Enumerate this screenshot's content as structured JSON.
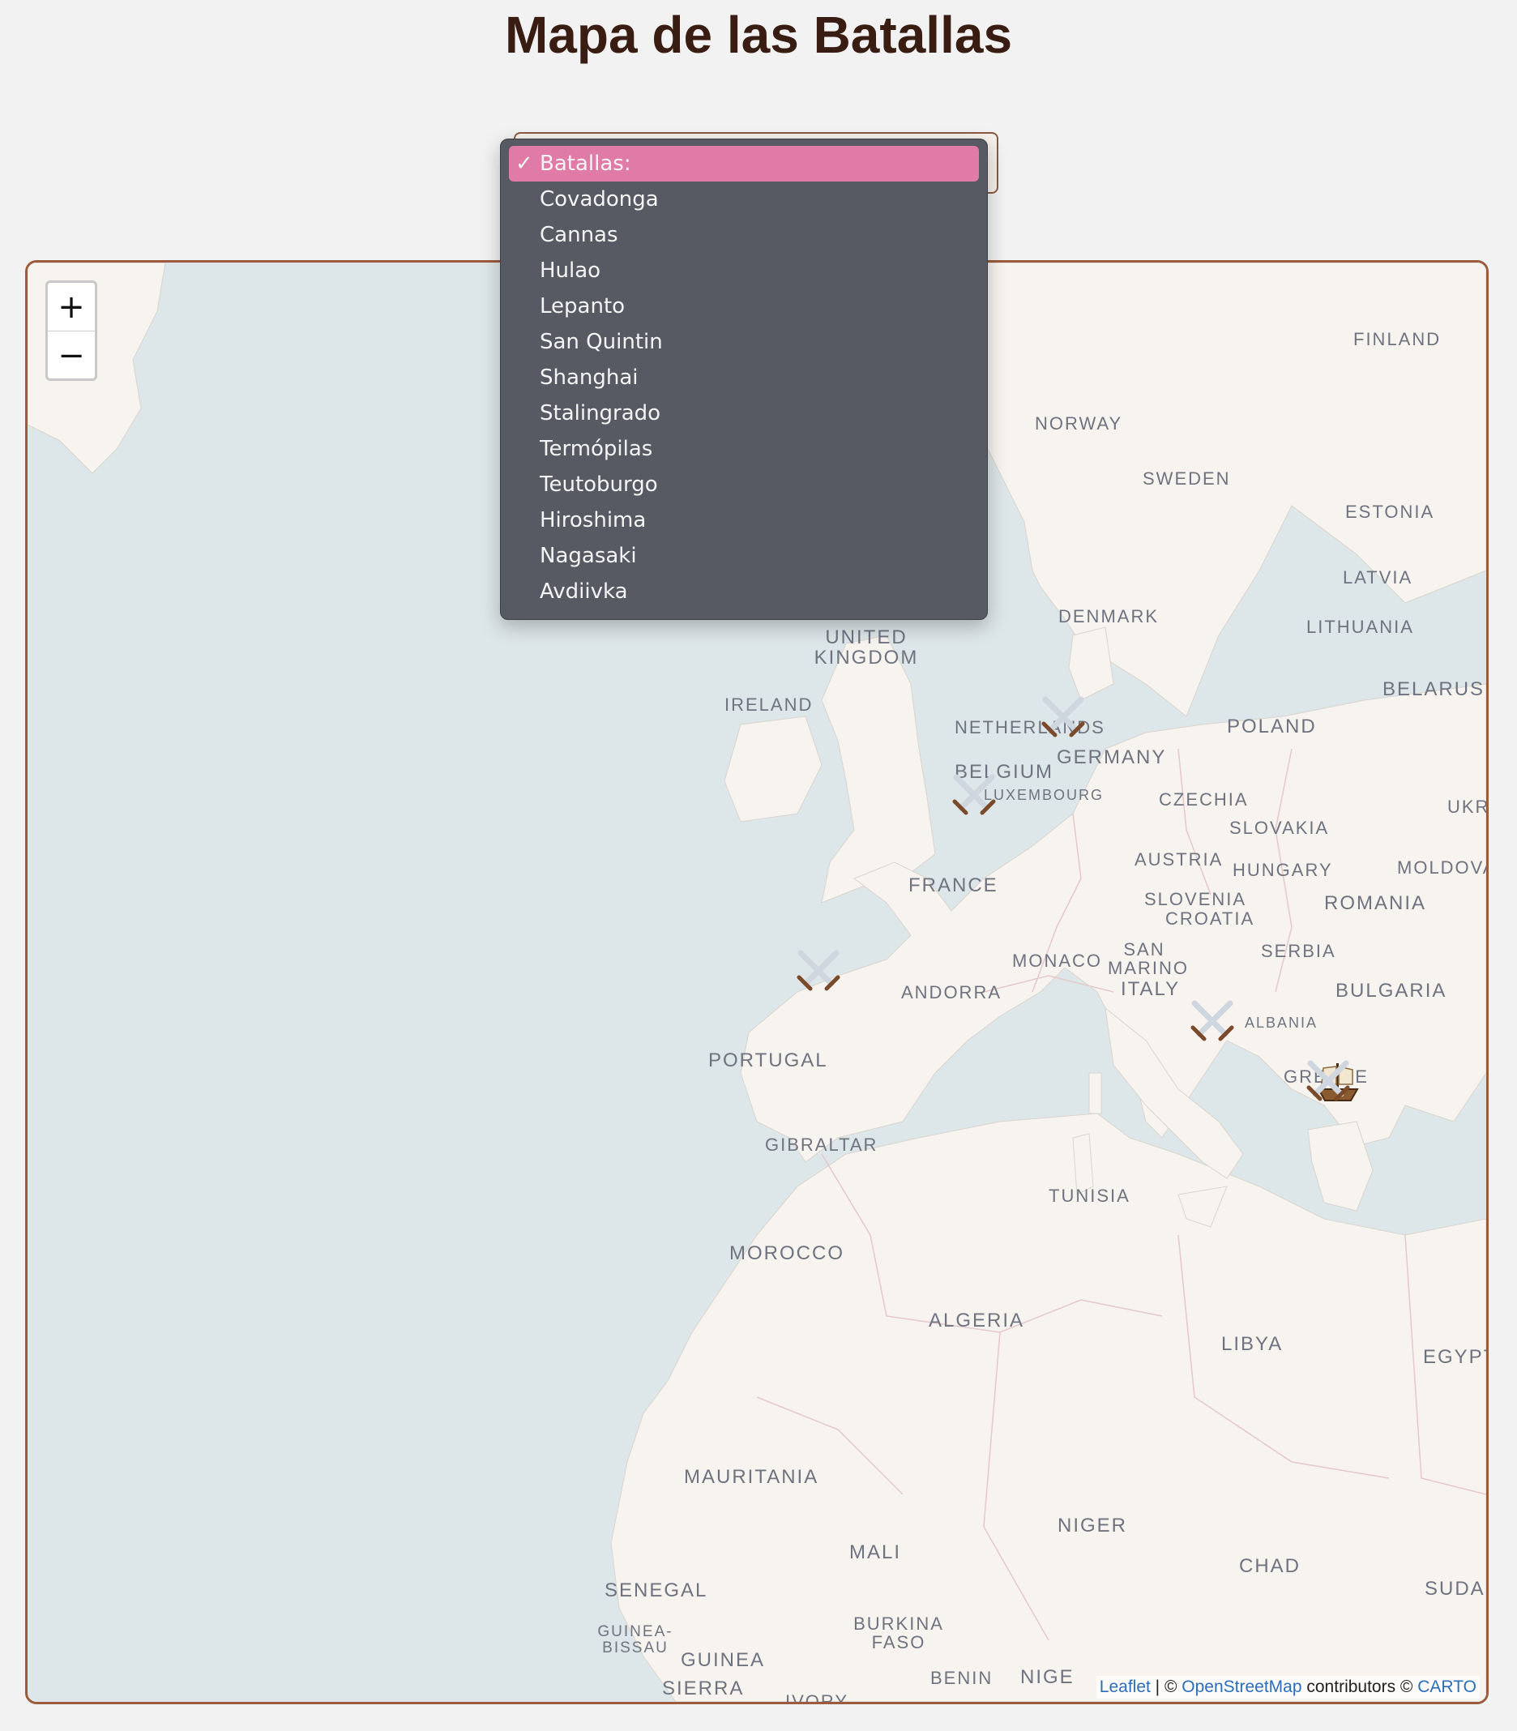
{
  "page": {
    "title": "Mapa de las Batallas"
  },
  "select": {
    "selected": "Batallas:",
    "options": [
      "Batallas:",
      "Covadonga",
      "Cannas",
      "Hulao",
      "Lepanto",
      "San Quintin",
      "Shanghai",
      "Stalingrado",
      "Termópilas",
      "Teutoburgo",
      "Hiroshima",
      "Nagasaki",
      "Avdiivka"
    ]
  },
  "map": {
    "zoom_in": "+",
    "zoom_out": "−",
    "labels": {
      "finland": "FINLAND",
      "norway": "NORWAY",
      "sweden": "SWEDEN",
      "estonia": "ESTONIA",
      "latvia": "LATVIA",
      "denmark": "DENMARK",
      "lithuania": "LITHUANIA",
      "united_kingdom": "UNITED KINGDOM",
      "belarus": "BELARUS",
      "ireland": "IRELAND",
      "poland": "POLAND",
      "netherlands": "NETHERLANDS",
      "germany": "GERMANY",
      "belgium": "BELGIUM",
      "luxembourg": "LUXEMBOURG",
      "czechia": "CZECHIA",
      "ukraine": "UKR",
      "slovakia": "SLOVAKIA",
      "austria": "AUSTRIA",
      "hungary": "HUNGARY",
      "moldova": "MOLDOVA",
      "france": "FRANCE",
      "slovenia": "SLOVENIA",
      "croatia": "CROATIA",
      "romania": "ROMANIA",
      "san_marino": "SAN MARINO",
      "serbia": "SERBIA",
      "monaco": "MONACO",
      "italy": "ITALY",
      "andorra": "ANDORRA",
      "bulgaria": "BULGARIA",
      "albania": "ALBANIA",
      "portugal": "PORTUGAL",
      "greece": "GREECE",
      "gibraltar": "GIBRALTAR",
      "tunisia": "TUNISIA",
      "morocco": "MOROCCO",
      "algeria": "ALGERIA",
      "libya": "LIBYA",
      "egypt": "EGYPT",
      "mauritania": "MAURITANIA",
      "niger": "NIGER",
      "mali": "MALI",
      "chad": "CHAD",
      "senegal": "SENEGAL",
      "sudan": "SUDAN",
      "burkina_faso": "BURKINA FASO",
      "guinea_bissau": "GUINEA-BISSAU",
      "guinea": "GUINEA",
      "benin": "BENIN",
      "nigeria": "NIGE",
      "sierra": "SIERRA",
      "ivory": "IVORY"
    },
    "markers": [
      {
        "name": "Teutoburgo",
        "icon": "crossed-swords-icon"
      },
      {
        "name": "San Quintin",
        "icon": "crossed-swords-icon"
      },
      {
        "name": "Covadonga",
        "icon": "crossed-swords-icon"
      },
      {
        "name": "Cannas",
        "icon": "crossed-swords-icon"
      },
      {
        "name": "Termópilas",
        "icon": "crossed-swords-icon"
      },
      {
        "name": "Lepanto",
        "icon": "sailing-ship-icon"
      }
    ],
    "attribution": {
      "leaflet": "Leaflet",
      "sep": " | © ",
      "osm": "OpenStreetMap",
      "contributors": " contributors © ",
      "carto": "CARTO"
    }
  },
  "colors": {
    "water": "#dde6e8",
    "land": "#f7f4f0",
    "border": "#9c5b3c",
    "title": "#3a1d12",
    "dropdown_bg": "#575a62",
    "dropdown_selected": "#e07aa6"
  }
}
